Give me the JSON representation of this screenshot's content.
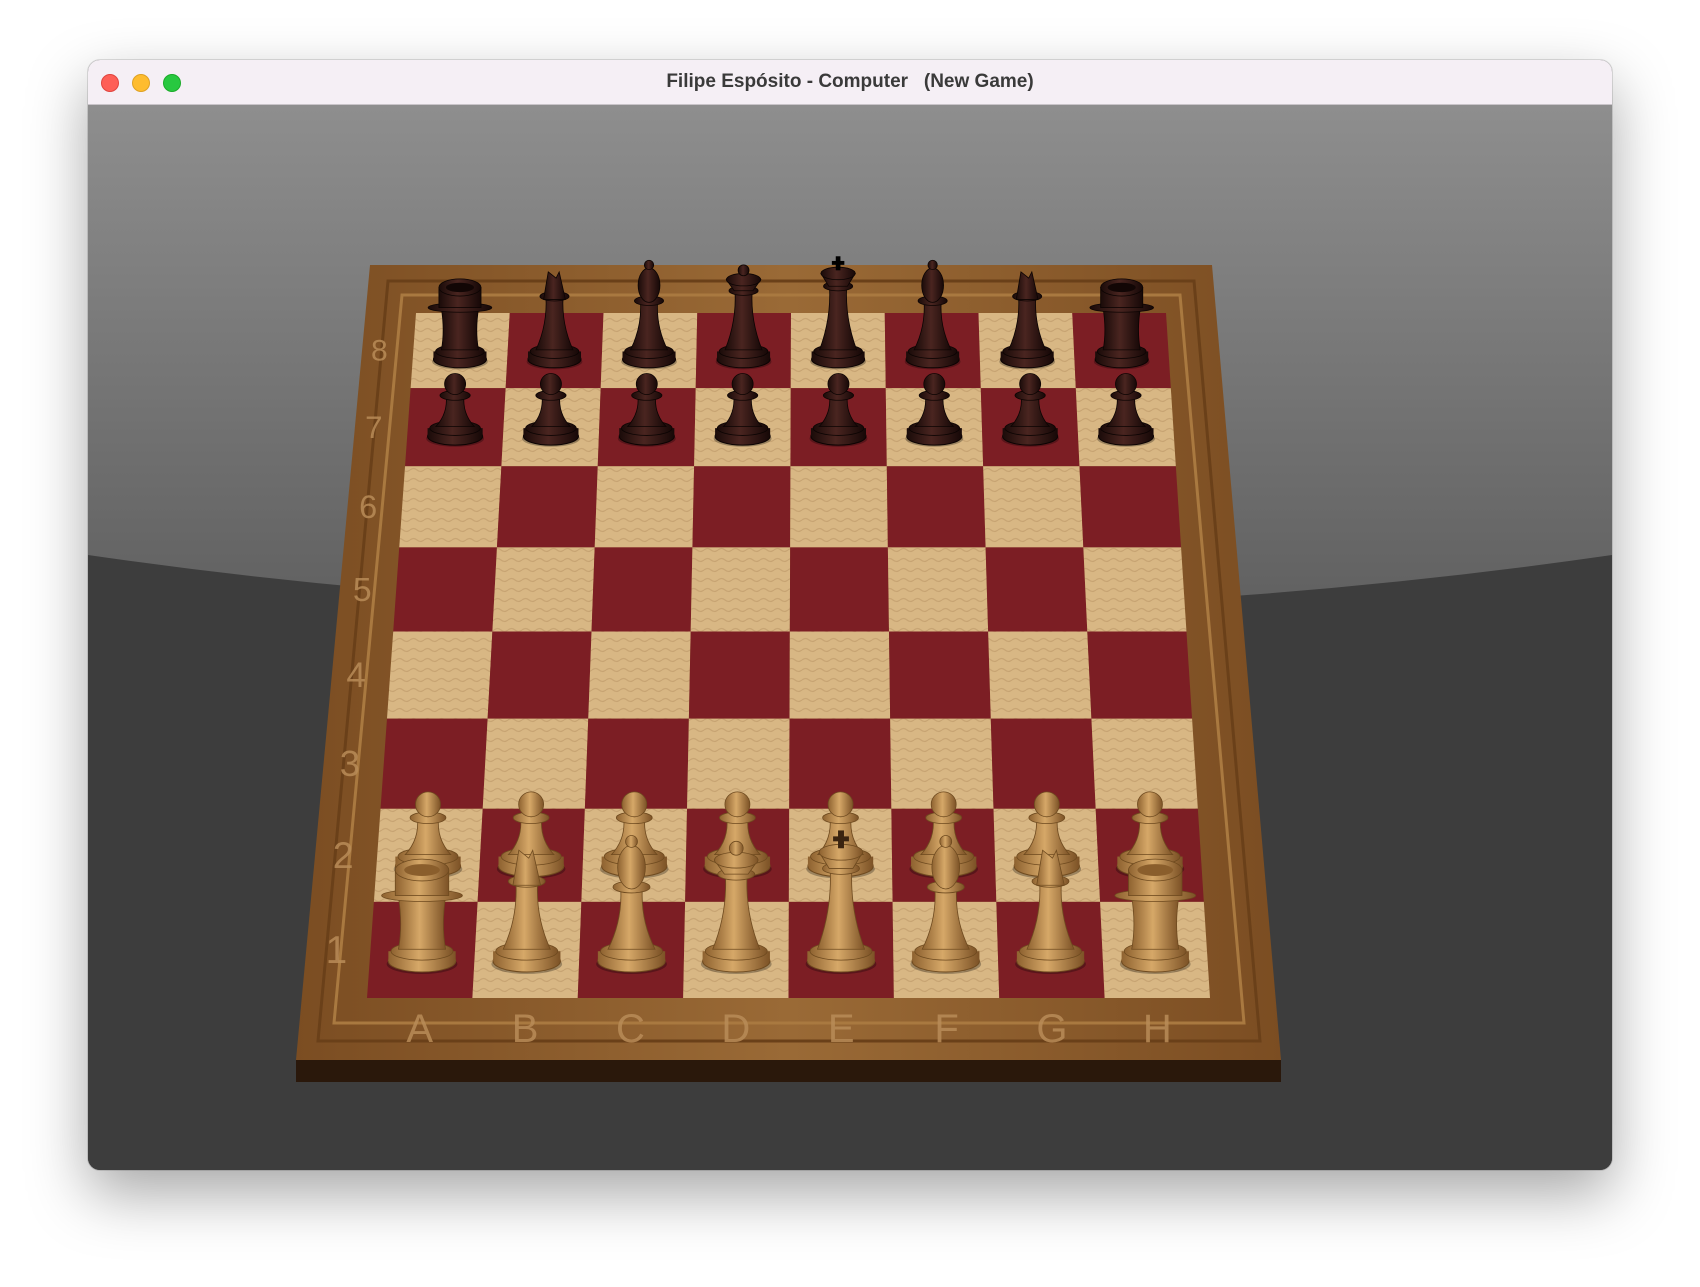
{
  "window": {
    "title": "Filipe Espósito - Computer   (New Game)",
    "controls": [
      "close-button",
      "minimize-button",
      "zoom-button"
    ]
  },
  "board": {
    "files": [
      "A",
      "B",
      "C",
      "D",
      "E",
      "F",
      "G",
      "H"
    ],
    "ranks": [
      "1",
      "2",
      "3",
      "4",
      "5",
      "6",
      "7",
      "8"
    ],
    "colors": {
      "light_square": "#d8b784",
      "dark_square": "#7c1e24",
      "frame": "#8a5a2b",
      "white_pieces": "#c08f4e",
      "black_pieces": "#2b1512"
    },
    "position": {
      "rank8": [
        "rook",
        "knight",
        "bishop",
        "queen",
        "king",
        "bishop",
        "knight",
        "rook"
      ],
      "rank7": [
        "pawn",
        "pawn",
        "pawn",
        "pawn",
        "pawn",
        "pawn",
        "pawn",
        "pawn"
      ],
      "rank2": [
        "pawn",
        "pawn",
        "pawn",
        "pawn",
        "pawn",
        "pawn",
        "pawn",
        "pawn"
      ],
      "rank1": [
        "rook",
        "knight",
        "bishop",
        "queen",
        "king",
        "bishop",
        "knight",
        "rook"
      ],
      "black_side": [
        "rank8",
        "rank7"
      ],
      "white_side": [
        "rank1",
        "rank2"
      ]
    }
  }
}
